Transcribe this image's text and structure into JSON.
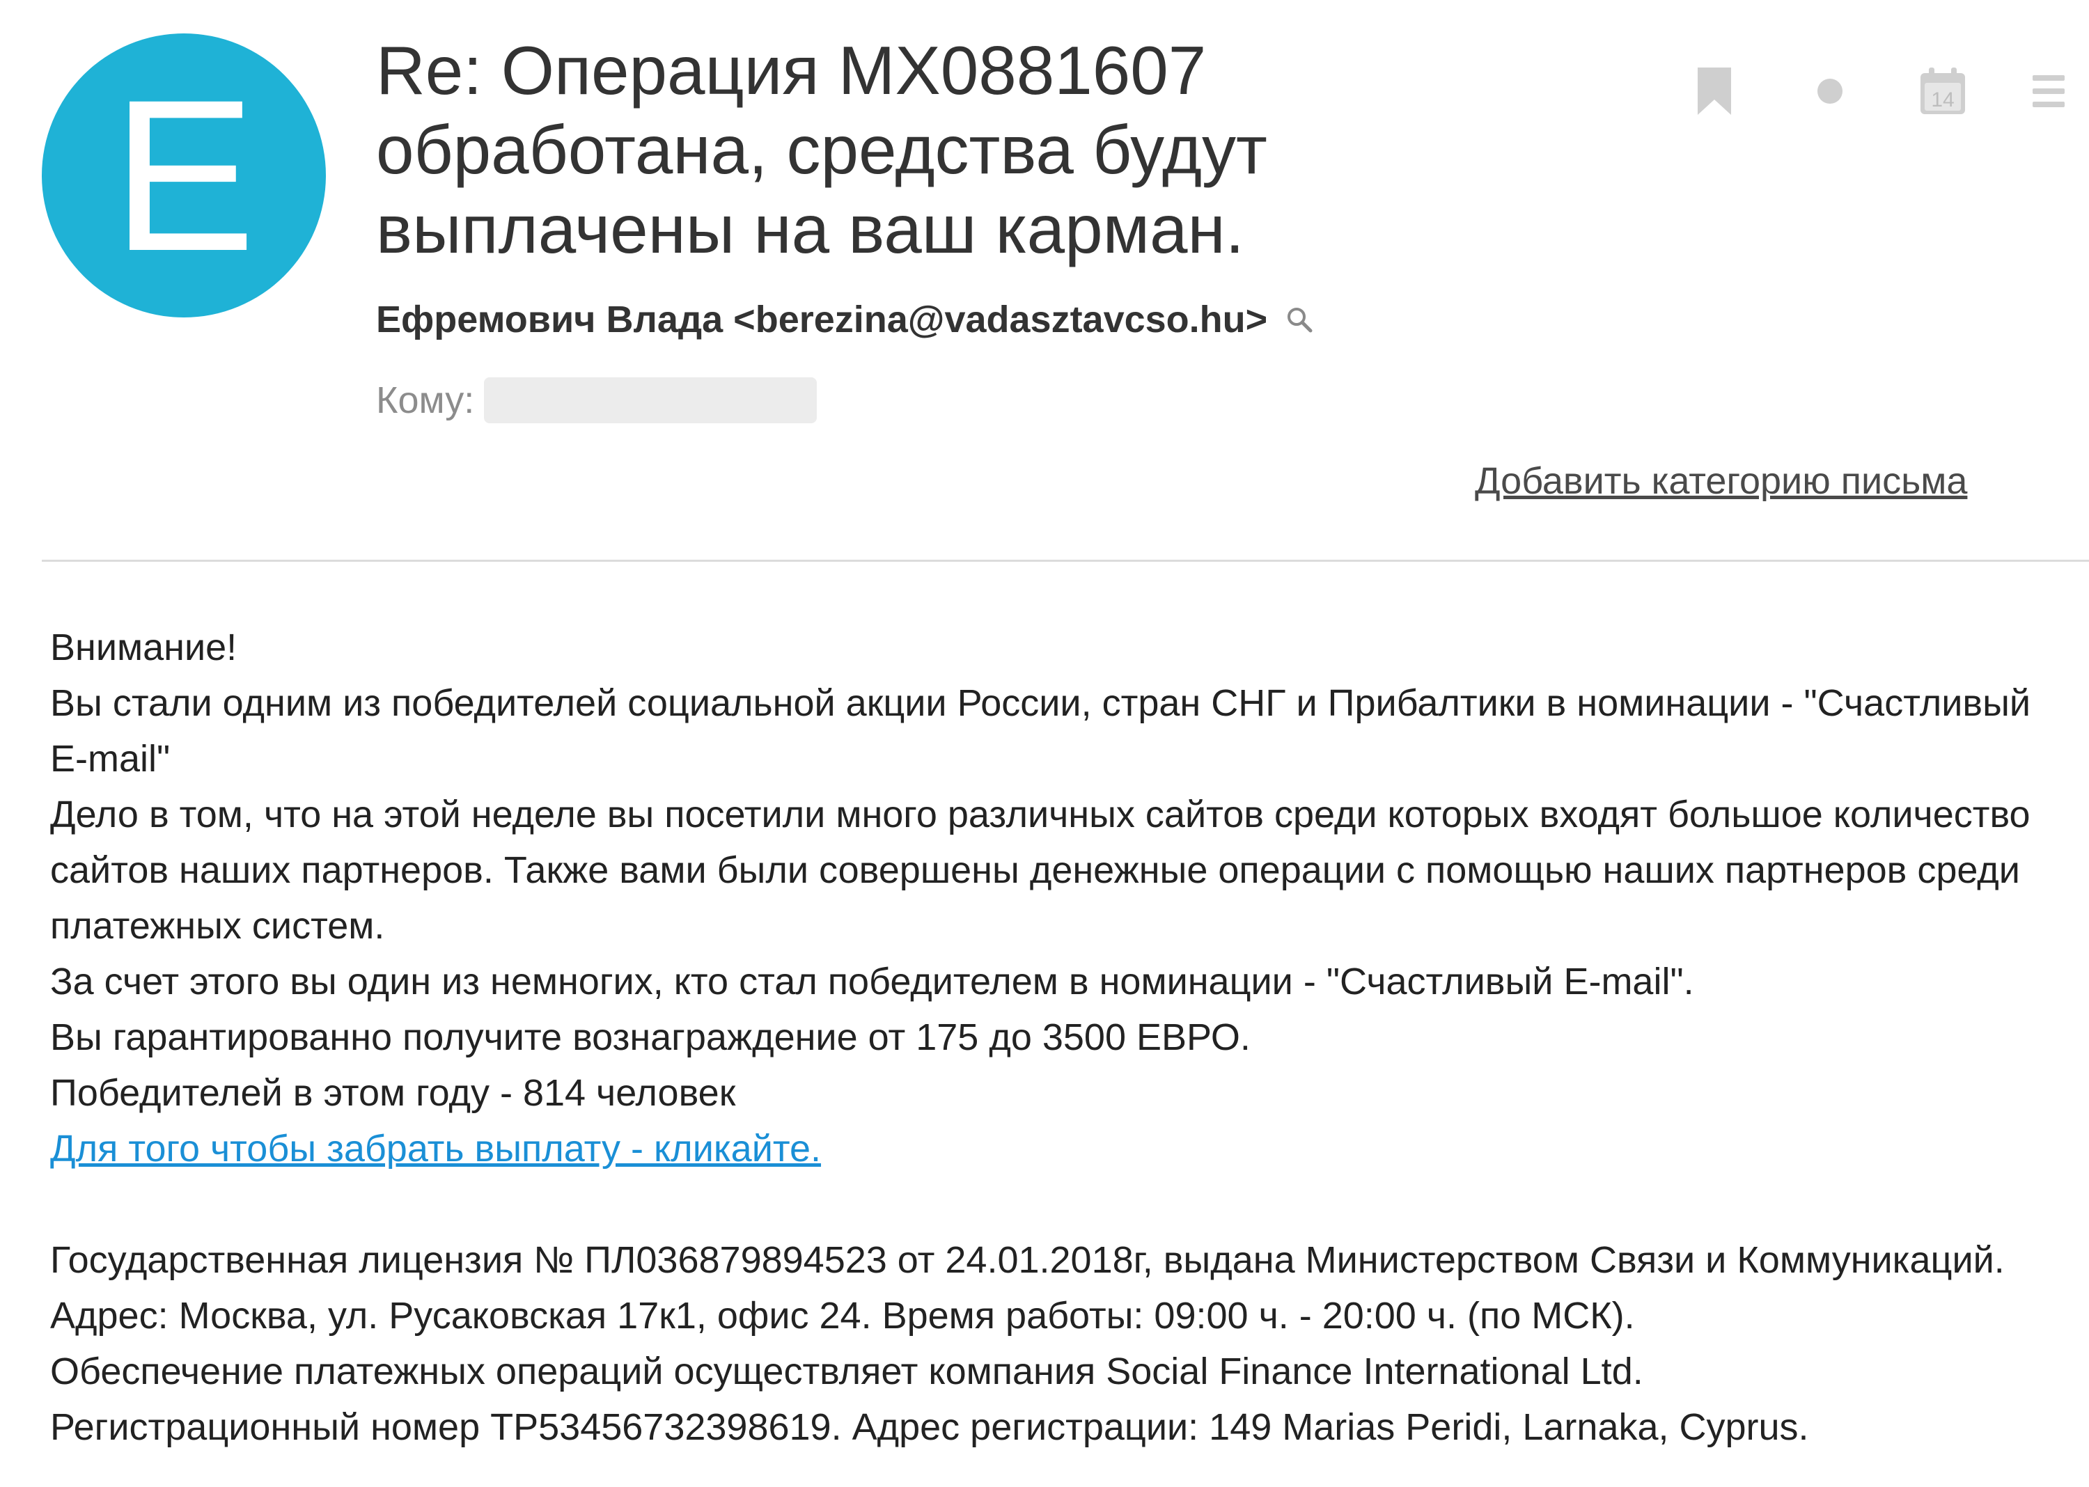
{
  "email": {
    "avatar_letter": "E",
    "avatar_color": "#1fb2d6",
    "subject": "Re: Операция MX0881607 обработана, средства будут выплачены на ваш карман.",
    "sender": "Ефремович Влада <berezina@vadasztavcso.hu>",
    "to_label": "Кому:",
    "add_category_link": "Добавить категорию письма"
  },
  "toolbar": {
    "icons": [
      "bookmark-icon",
      "unread-dot-icon",
      "calendar-icon",
      "menu-icon"
    ],
    "calendar_day": "14"
  },
  "body": {
    "line1": "Внимание!",
    "line2": "Вы стали одним из победителей социальной акции России, стран СНГ и Прибалтики в номинации - \"Счастливый E-mail\"",
    "line3": "Дело в том, что на этой неделе вы посетили много различных сайтов среди которых входят большое количество сайтов наших партнеров. Также вами были совершены денежные операции с помощью наших партнеров среди платежных систем.",
    "line4": "За счет этого вы один из немногих, кто стал победителем в номинации - \"Счастливый E-mail\".",
    "line5": "Вы гарантированно получите вознаграждение от 175 до 3500 ЕВРО.",
    "line6": "Победителей в этом году - 814 человек",
    "link": "Для того чтобы забрать выплату - кликайте.",
    "footer1": "Государственная лицензия № ПЛ036879894523 от 24.01.2018г, выдана Министерством Связи и Коммуникаций. Адрес: Москва, ул. Русаковская 17к1, офис 24. Время работы: 09:00 ч. - 20:00 ч. (по МСК).",
    "footer2": "Обеспечение платежных операций осуществляет компания Social Finance International Ltd.",
    "footer3": "Регистрационный номер TP53456732398619. Адрес регистрации: 149 Marias Peridi, Larnaka, Cyprus."
  },
  "colors": {
    "link": "#1a8fd6",
    "icon": "#cfcfcf",
    "divider": "#dcdcdc"
  }
}
